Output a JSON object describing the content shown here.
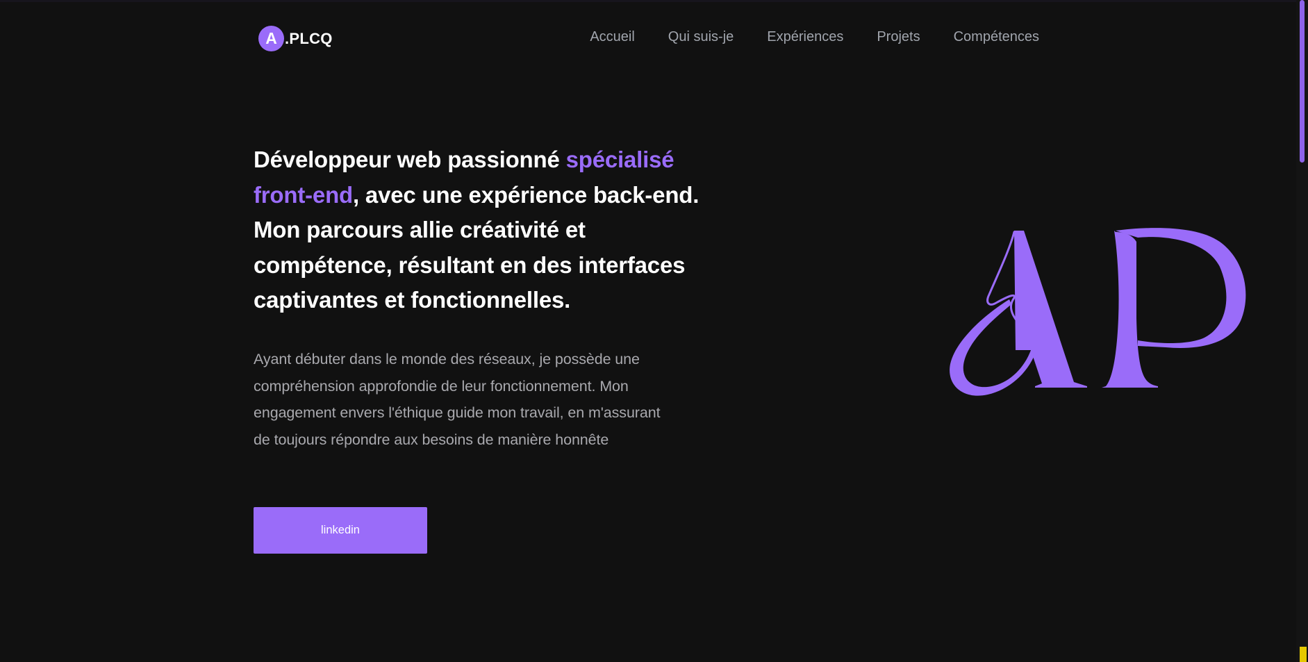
{
  "header": {
    "logo_letter": "A",
    "logo_text": ".PLCQ",
    "nav": [
      "Accueil",
      "Qui suis-je",
      "Expériences",
      "Projets",
      "Compétences"
    ]
  },
  "hero": {
    "headline_part1": "Développeur web passionné ",
    "headline_accent": "spécialisé front-end",
    "headline_part2": ", avec une expérience back-end. Mon parcours allie créativité et compétence, résultant en des interfaces captivantes et fonctionnelles.",
    "intro": "Ayant débuter dans le monde des réseaux, je possède une compréhension approfondie de leur fonctionnement. Mon engagement envers l'éthique guide mon travail, en m'assurant de toujours répondre aux besoins de manière honnête",
    "cta_label": "linkedin",
    "monogram": "AP"
  },
  "colors": {
    "background": "#111111",
    "accent": "#9a6cf9",
    "text": "#ffffff",
    "muted": "#a9a9ae"
  }
}
